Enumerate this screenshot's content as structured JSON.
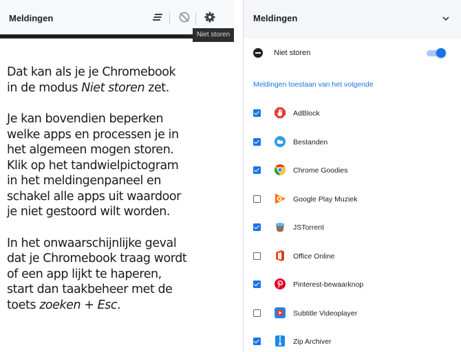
{
  "mini_panel": {
    "title": "Meldingen",
    "tooltip": "Niet storen",
    "icons": [
      "clear-all-icon",
      "do-not-disturb-icon",
      "gear-icon"
    ]
  },
  "article": {
    "p1_pre": "Dat kan als je je Chromebook",
    "p1_mid": "in de modus ",
    "p1_em": "Niet storen",
    "p1_post": " zet.",
    "p2_lines": [
      "Je kan bovendien beperken",
      "welke apps en processen je in",
      "het algemeen mogen storen.",
      "Klik op het tandwielpictogram",
      "in het meldingenpaneel en",
      "schakel alle apps uit waardoor",
      "je niet gestoord wilt worden."
    ],
    "p3_lines": [
      "In het onwaarschijnlijke geval",
      "dat je Chromebook traag wordt",
      "of een app lijkt te haperen,",
      "start dan taakbeheer met de"
    ],
    "p3_last_pre": "toets ",
    "p3_last_em": "zoeken",
    "p3_last_plus": " + ",
    "p3_last_em2": "Esc",
    "p3_last_post": "."
  },
  "settings": {
    "title": "Meldingen",
    "dnd_label": "Niet storen",
    "dnd_on": true,
    "section_label": "Meldingen toestaan van het volgende",
    "accent_color": "#1a73e8",
    "apps": [
      {
        "label": "AdBlock",
        "checked": true,
        "icon": "adblock-icon"
      },
      {
        "label": "Bestanden",
        "checked": true,
        "icon": "files-icon"
      },
      {
        "label": "Chrome Goodies",
        "checked": true,
        "icon": "chrome-icon"
      },
      {
        "label": "Google Play Muziek",
        "checked": false,
        "icon": "play-music-icon"
      },
      {
        "label": "JSTorrent",
        "checked": true,
        "icon": "jstorrent-icon"
      },
      {
        "label": "Office Online",
        "checked": false,
        "icon": "office-icon"
      },
      {
        "label": "Pinterest-bewaarknop",
        "checked": true,
        "icon": "pinterest-icon"
      },
      {
        "label": "Subtitle Videoplayer",
        "checked": false,
        "icon": "video-player-icon"
      },
      {
        "label": "Zip Archiver",
        "checked": true,
        "icon": "zip-archiver-icon"
      }
    ]
  }
}
